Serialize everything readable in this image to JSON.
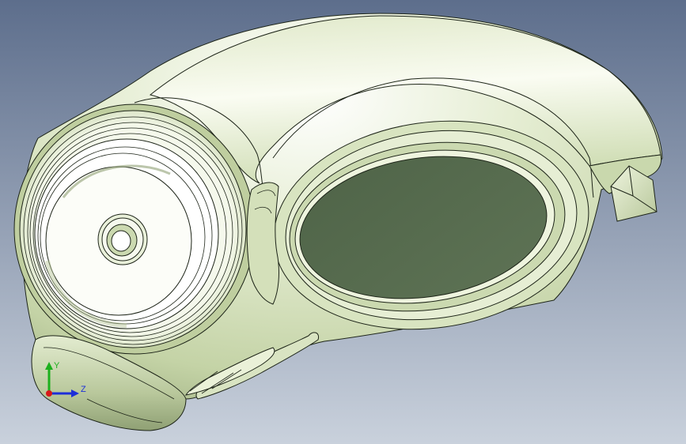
{
  "viewport": {
    "background_top": "#5d6e8c",
    "background_bottom": "#c9d1dc"
  },
  "model": {
    "body_color": "#cfdcb4",
    "body_highlight": "#f3f7e8",
    "body_shadow": "#8fa074",
    "lens_color": "#55694d",
    "edge_color": "#1d2418"
  },
  "triad": {
    "y_label": "Y",
    "z_label": "Z",
    "x_color": "#d81818",
    "y_color": "#1db01d",
    "z_color": "#1c2fd8"
  }
}
